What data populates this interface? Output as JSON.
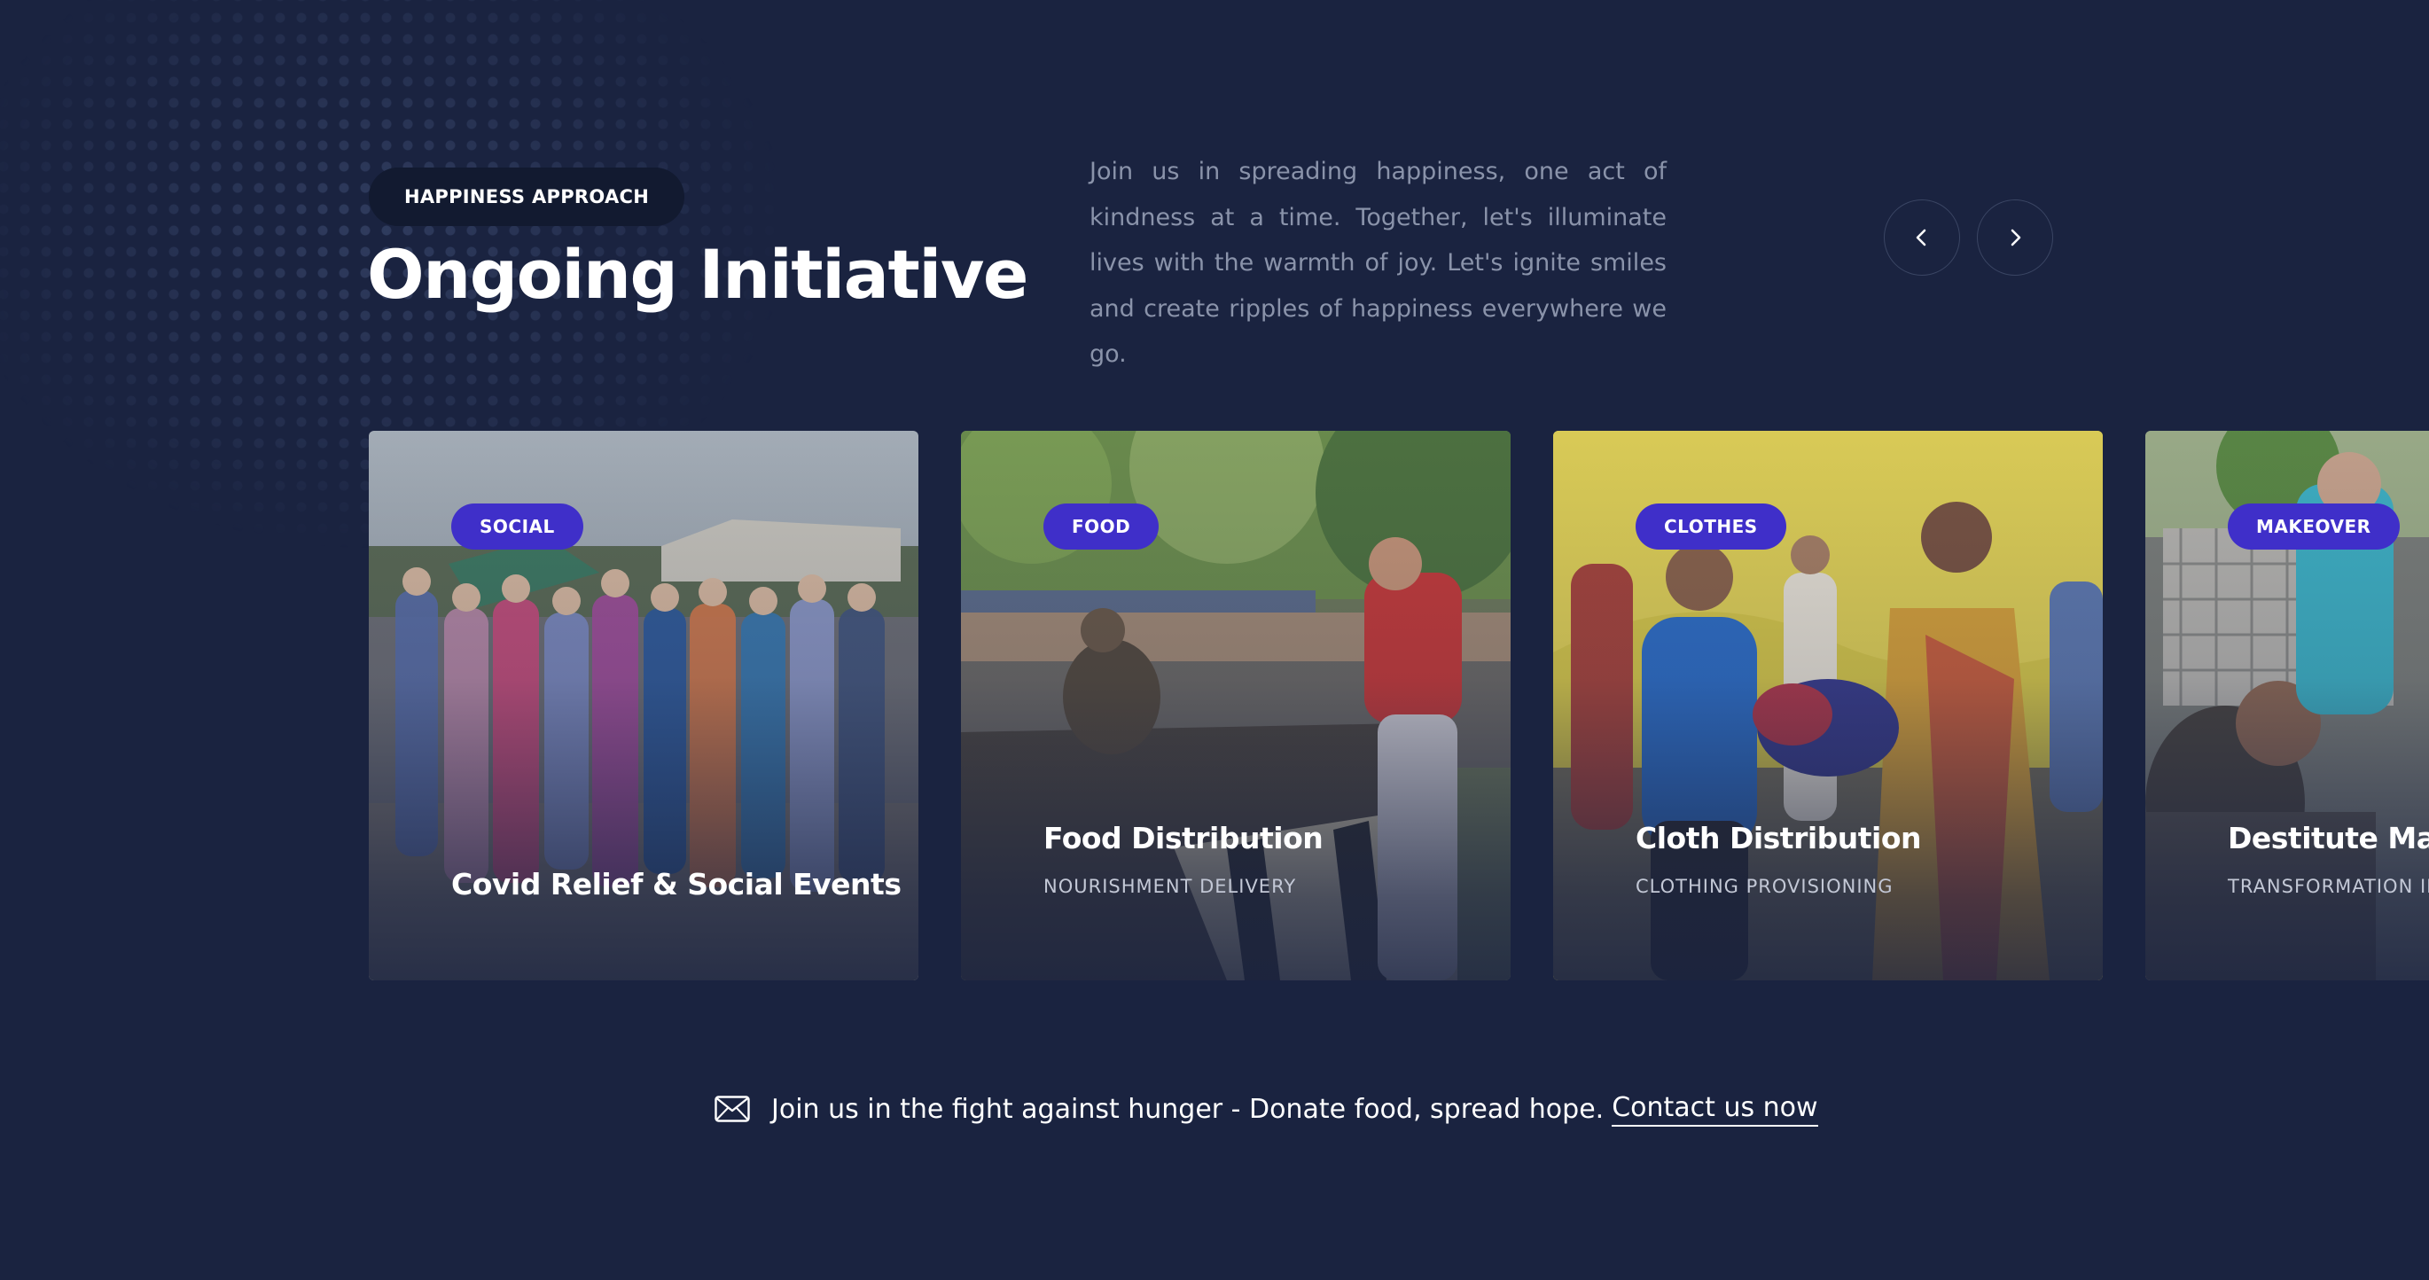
{
  "header": {
    "eyebrow": "HAPPINESS APPROACH",
    "title": "Ongoing Initiative",
    "intro": "Join us in spreading happiness, one act of kindness at a time. Together, let's illuminate lives with the warmth of joy. Let's ignite smiles and create ripples of happiness everywhere we go."
  },
  "carousel": {
    "prev_icon": "chevron-left-icon",
    "next_icon": "chevron-right-icon",
    "cards": [
      {
        "tag": "SOCIAL",
        "title": "Covid Relief & Social Events",
        "subtitle": ""
      },
      {
        "tag": "FOOD",
        "title": "Food Distribution",
        "subtitle": "NOURISHMENT DELIVERY"
      },
      {
        "tag": "CLOTHES",
        "title": "Cloth Distribution",
        "subtitle": "CLOTHING PROVISIONING"
      },
      {
        "tag": "MAKEOVER",
        "title": "Destitute Makeover",
        "subtitle": "TRANSFORMATION INITIATIVE"
      }
    ]
  },
  "cta": {
    "icon": "mail-icon",
    "text": "Join us in the fight against hunger - Donate food, spread hope.",
    "link_label": "Contact us now"
  },
  "colors": {
    "background": "#1a2340",
    "accent_tag": "#3f2fc9",
    "eyebrow_bg": "#121a30",
    "muted_text": "#8a93aa"
  }
}
